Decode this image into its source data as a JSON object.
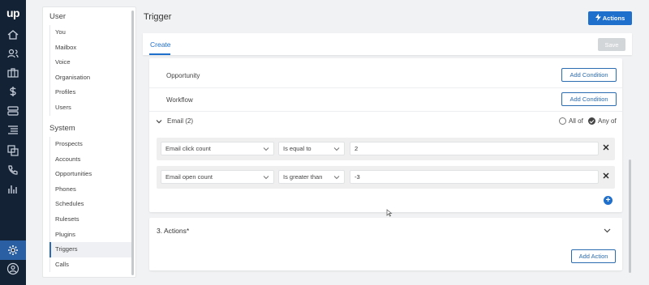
{
  "app": {
    "logo": "up"
  },
  "rail": {
    "icons": [
      "home-icon",
      "users-icon",
      "briefcase-icon",
      "dollar-icon",
      "server-icon",
      "list-icon",
      "copy-icon",
      "phone-icon",
      "bar-chart-icon",
      "gear-icon",
      "user-circle-icon"
    ]
  },
  "sidebar": {
    "user_title": "User",
    "user_items": [
      "You",
      "Mailbox",
      "Voice",
      "Organisation",
      "Profiles",
      "Users"
    ],
    "system_title": "System",
    "system_items": [
      "Prospects",
      "Accounts",
      "Opportunities",
      "Phones",
      "Schedules",
      "Rulesets",
      "Plugins",
      "Triggers",
      "Calls"
    ],
    "active_item": "Triggers"
  },
  "header": {
    "title": "Trigger",
    "actions_label": "Actions"
  },
  "tabs": {
    "create_label": "Create",
    "save_label": "Save"
  },
  "conditions": {
    "rows": [
      {
        "label": "Opportunity",
        "button": "Add Condition"
      },
      {
        "label": "Workflow",
        "button": "Add Condition"
      }
    ],
    "email": {
      "label": "Email (2)",
      "match_all": "All of",
      "match_any": "Any of",
      "selected": "Any of",
      "items": [
        {
          "field": "Email click count",
          "operator": "Is equal to",
          "value": "2"
        },
        {
          "field": "Email open count",
          "operator": "Is greater than",
          "value": "-3"
        }
      ]
    }
  },
  "actions_section": {
    "title": "3. Actions*",
    "add_label": "Add Action"
  },
  "colors": {
    "rail": "#142236",
    "primary": "#1f6fcd",
    "outline": "#2b6cb0"
  }
}
